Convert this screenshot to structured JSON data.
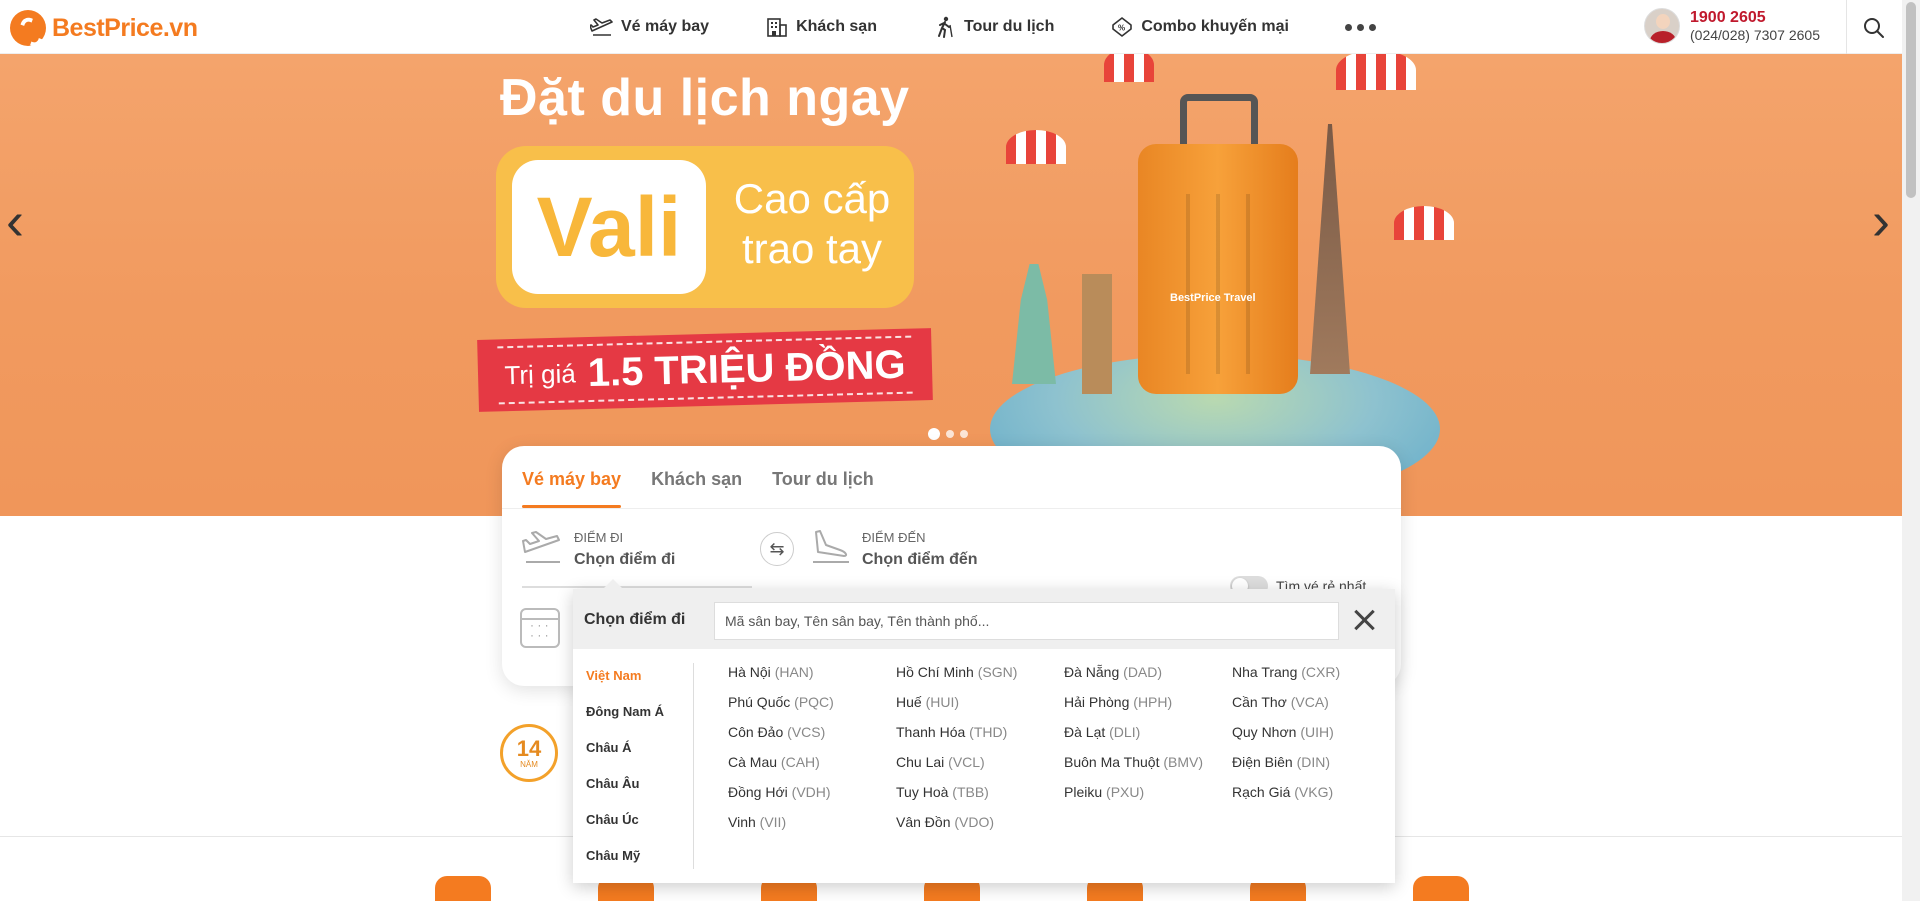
{
  "header": {
    "logo_text": "BestPrice.vn",
    "nav": [
      {
        "label": "Vé máy bay",
        "icon": "plane-icon"
      },
      {
        "label": "Khách sạn",
        "icon": "hotel-icon"
      },
      {
        "label": "Tour du lịch",
        "icon": "hiker-icon"
      },
      {
        "label": "Combo khuyến mại",
        "icon": "ticket-icon"
      }
    ],
    "more_icon": "more-dots-icon",
    "hotline": "1900 2605",
    "hotline_sub": "(024/028) 7307 2605",
    "search_icon": "search-icon"
  },
  "banner": {
    "headline": "Đặt du lịch ngay",
    "vali_word": "Vali",
    "vali_side_line1": "Cao cấp",
    "vali_side_line2": "trao tay",
    "price_prefix": "Trị giá",
    "price_value": "1.5 TRIỆU ĐỒNG",
    "suitcase_label": "BestPrice Travel",
    "arrow_left": "‹",
    "arrow_right": "›",
    "slide_count": 3,
    "active_slide": 1
  },
  "search": {
    "tabs": [
      {
        "label": "Vé máy bay",
        "active": true
      },
      {
        "label": "Khách sạn",
        "active": false
      },
      {
        "label": "Tour du lịch",
        "active": false
      }
    ],
    "from_label": "ĐIỂM ĐI",
    "from_value": "Chọn điểm đi",
    "to_label": "ĐIỂM ĐẾN",
    "to_value": "Chọn điểm đến",
    "swap_symbol": "⇆",
    "toggle_label": "Tìm vé rẻ nhất"
  },
  "dropdown": {
    "title": "Chọn điểm đi",
    "placeholder": "Mã sân bay, Tên sân bay, Tên thành phố...",
    "regions": [
      {
        "label": "Việt Nam",
        "active": true
      },
      {
        "label": "Đông Nam Á",
        "active": false
      },
      {
        "label": "Châu Á",
        "active": false
      },
      {
        "label": "Châu Âu",
        "active": false
      },
      {
        "label": "Châu Úc",
        "active": false
      },
      {
        "label": "Châu Mỹ",
        "active": false
      }
    ],
    "cities": [
      {
        "name": "Hà Nội",
        "code": "(HAN)"
      },
      {
        "name": "Hồ Chí Minh",
        "code": "(SGN)"
      },
      {
        "name": "Đà Nẵng",
        "code": "(DAD)"
      },
      {
        "name": "Nha Trang",
        "code": "(CXR)"
      },
      {
        "name": "Phú Quốc",
        "code": "(PQC)"
      },
      {
        "name": "Huế",
        "code": "(HUI)"
      },
      {
        "name": "Hải Phòng",
        "code": "(HPH)"
      },
      {
        "name": "Cần Thơ",
        "code": "(VCA)"
      },
      {
        "name": "Côn Đảo",
        "code": "(VCS)"
      },
      {
        "name": "Thanh Hóa",
        "code": "(THD)"
      },
      {
        "name": "Đà Lạt",
        "code": "(DLI)"
      },
      {
        "name": "Quy Nhơn",
        "code": "(UIH)"
      },
      {
        "name": "Cà Mau",
        "code": "(CAH)"
      },
      {
        "name": "Chu Lai",
        "code": "(VCL)"
      },
      {
        "name": "Buôn Ma Thuột",
        "code": "(BMV)"
      },
      {
        "name": "Điện Biên",
        "code": "(DIN)"
      },
      {
        "name": "Đồng Hới",
        "code": "(VDH)"
      },
      {
        "name": "Tuy Hoà",
        "code": "(TBB)"
      },
      {
        "name": "Pleiku",
        "code": "(PXU)"
      },
      {
        "name": "Rạch Giá",
        "code": "(VKG)"
      },
      {
        "name": "Vinh",
        "code": "(VII)"
      },
      {
        "name": "Vân Đồn",
        "code": "(VDO)"
      }
    ]
  },
  "trust": {
    "badge_number": "14",
    "badge_text": "NĂM"
  },
  "colors": {
    "brand": "#f47b20",
    "hotline": "#c0192d",
    "banner_bg": "#f19a5f"
  }
}
